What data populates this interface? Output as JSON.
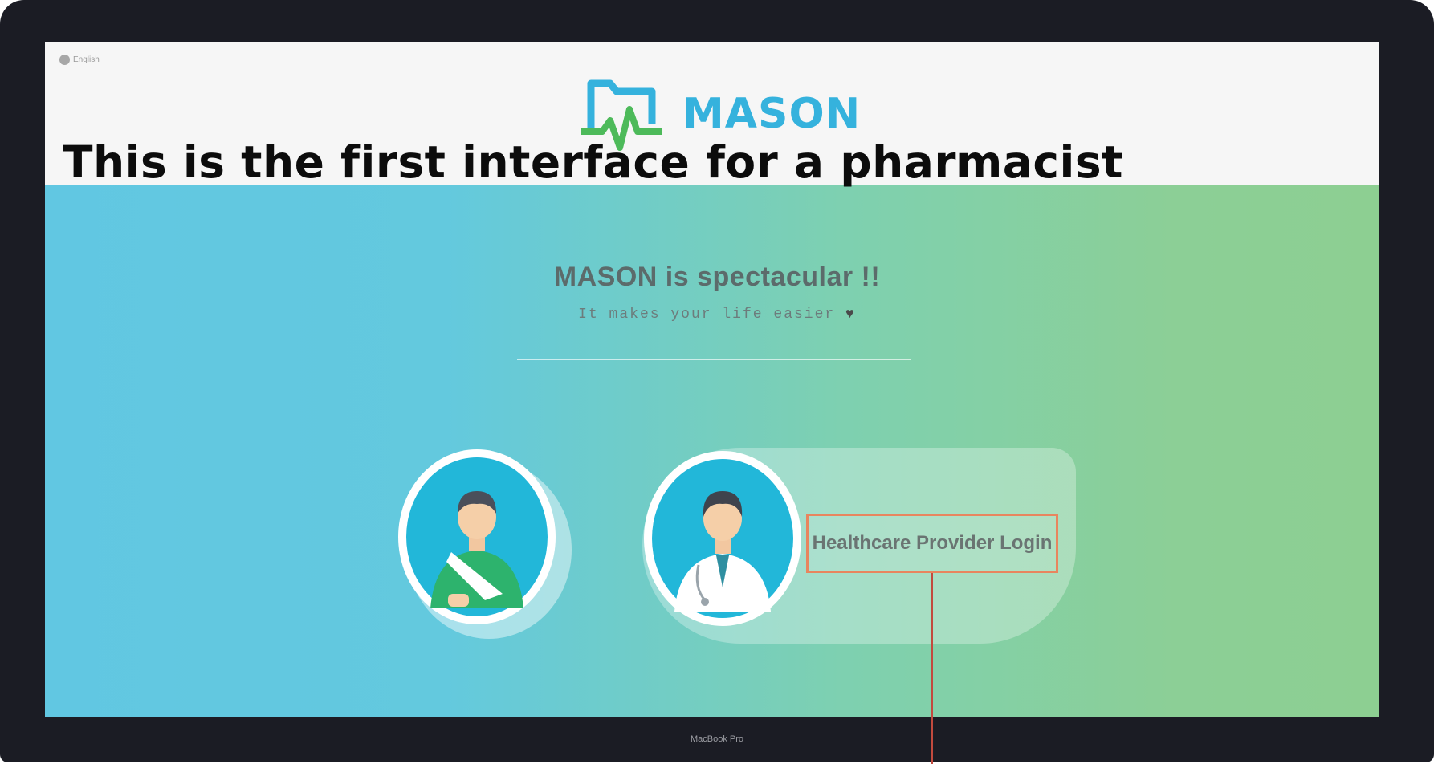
{
  "caption": "This is the first interface for a pharmacist",
  "header": {
    "language_label": "English",
    "brand_name": "MASON"
  },
  "hero": {
    "tagline": "MASON is spectacular !!",
    "subtagline": "It makes your life easier"
  },
  "roles": {
    "patient_icon": "patient-avatar",
    "provider_icon": "doctor-avatar",
    "provider_login_label": "Healthcare Provider Login"
  },
  "device_label": "MacBook Pro",
  "colors": {
    "brand_blue": "#35b2dd",
    "brand_green": "#4dba5a",
    "hero_left": "#61c7e2",
    "hero_right": "#8dcf92",
    "highlight": "#e8855e"
  }
}
